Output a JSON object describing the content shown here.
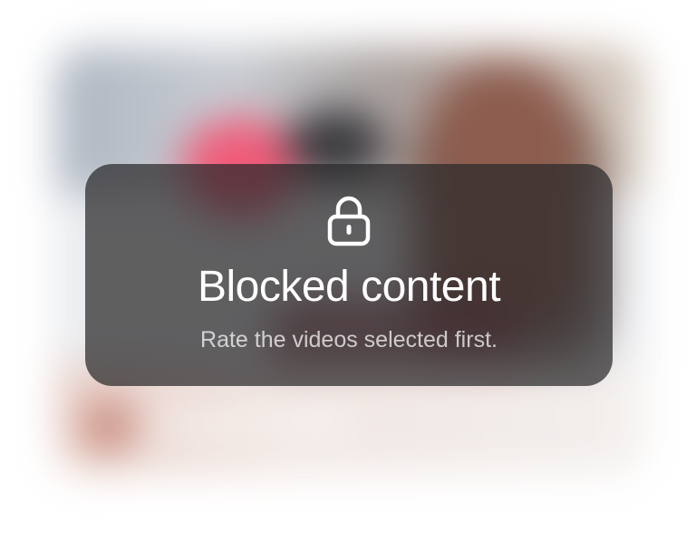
{
  "overlay": {
    "icon": "lock-icon",
    "title": "Blocked content",
    "subtitle": "Rate the videos selected first."
  }
}
